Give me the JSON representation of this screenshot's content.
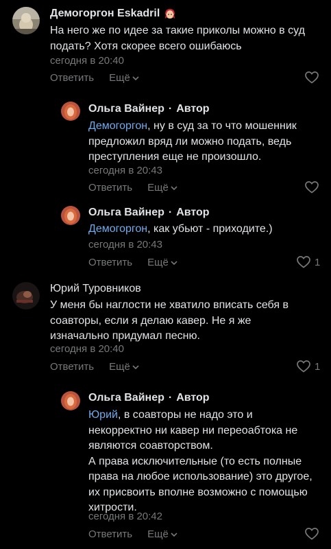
{
  "comments": [
    {
      "author": "Демогоргон Eskadril",
      "text": "На него же по идее за такие приколы можно в суд подать? Хотя скорее всего ошибаюсь",
      "time": "сегодня в 20:40",
      "reply_label": "Ответить",
      "more_label": "Ещё",
      "likes": ""
    },
    {
      "author": "Ольга Вайнер",
      "author_badge": "Автор",
      "separator": "·",
      "mention": "Демогоргон",
      "text": ", ну в суд за то что мошенник предложил вряд ли можно подать, ведь преступления еще не произошло.",
      "time": "сегодня в 20:43",
      "reply_label": "Ответить",
      "more_label": "Ещё",
      "likes": ""
    },
    {
      "author": "Ольга Вайнер",
      "author_badge": "Автор",
      "separator": "·",
      "mention": "Демогоргон",
      "text": ", как убьют - приходите.)",
      "time": "сегодня в 20:43",
      "reply_label": "Ответить",
      "more_label": "Ещё",
      "likes": "1"
    },
    {
      "author": "Юрий Туровников",
      "text": "У меня бы наглости не хватило вписать себя в соавторы, если я делаю кавер. Не я же изначально придумал песню.",
      "time": "сегодня в 20:40",
      "reply_label": "Ответить",
      "more_label": "Ещё",
      "likes": "1"
    },
    {
      "author": "Ольга Вайнер",
      "author_badge": "Автор",
      "separator": "·",
      "mention": "Юрий",
      "text": ", в соавторы не надо это и некорректно ни кавер ни переоабтока не являются соавторством.",
      "text2": "А права исключительные (то есть полные права на любое использование) это другое, их присвоить вполне возможно с помощью хитрости.",
      "time": "сегодня в 20:42",
      "reply_label": "Ответить",
      "more_label": "Ещё",
      "likes": ""
    }
  ],
  "icons": {
    "heart": "heart-icon",
    "chevron": "chevron-down-icon",
    "emoji_badge": "girl-emoji-icon"
  },
  "colors": {
    "background": "#000000",
    "text": "#e1e3e6",
    "secondary": "#76787a",
    "mention": "#71aaeb"
  }
}
